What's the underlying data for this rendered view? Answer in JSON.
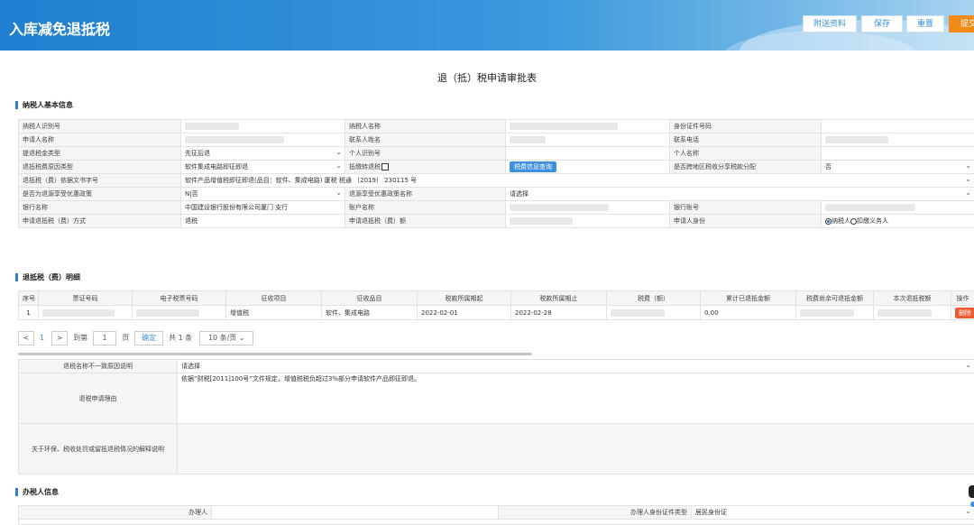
{
  "header": {
    "title": "入库减免退抵税",
    "attach_label": "附送资料",
    "save_label": "保存",
    "reset_label": "重置",
    "submit_label": "提交"
  },
  "page_title": "退（抵）税申请审批表",
  "sections": {
    "taxpayer": "纳税人基本信息",
    "detail": "退抵税（费）明细",
    "handler": "办税人信息"
  },
  "basic": {
    "taxpayer_id": "纳税人识别号",
    "taxpayer_name": "纳税人名称",
    "id_doc_no": "身份证件号码",
    "applicant_name": "申请人名称",
    "contact_name": "联系人姓名",
    "contact_phone": "联系电话",
    "refund_type": "提退税金类型",
    "refund_type_value": "先征后退",
    "personal_id": "个人识别号",
    "personal_name": "个人名称",
    "reason_type": "退抵税费原因类型",
    "reason_type_value": "软件集成电路即征即退",
    "convert_label": "抵缴转退税",
    "query_button": "税费信息查询",
    "cross_region": "是否跨地区税收分享税款分配",
    "cross_region_value": "否",
    "doc_no": "退抵税（费）依据文书字号",
    "doc_no_value": "软件产品增值税即征即退(品目：软件、集成电路) 厦税 税通 〔2019〕 230115 号",
    "is_pref": "是否为退源享受优惠政策",
    "is_pref_value": "N|否",
    "pref_name": "退源享受优惠政策名称",
    "pref_name_value": "请选择",
    "bank_name": "银行名称",
    "bank_name_value": "中国建设银行股份有限公司厦门      支行",
    "account_name": "账户名称",
    "bank_account": "银行账号",
    "method": "申请退抵税（费）方式",
    "method_value": "退税",
    "amount": "申请退抵税（费）额",
    "identity": "申请人身份",
    "identity_opt1": "纳税人",
    "identity_opt2": "扣缴义务人"
  },
  "detail_table": {
    "headers": [
      "序号",
      "票证号码",
      "电子税票号码",
      "征收项目",
      "征收品目",
      "税款所属期起",
      "税款所属期止",
      "税费（额）",
      "累计已退抵金额",
      "税费尚余可退抵金额",
      "本次退抵税额",
      "操作"
    ],
    "rows": [
      {
        "seq": "1",
        "ticket": "",
        "eticket": "",
        "item": "增值税",
        "subitem": "软件、集成电路",
        "start": "2022-02-01",
        "end": "2022-02-28",
        "amount": "",
        "refunded": "0.00",
        "remain": "",
        "current": "",
        "op": "删除"
      }
    ]
  },
  "pager": {
    "current": "1",
    "goto_label": "到第",
    "page_label": "页",
    "confirm": "确定",
    "total": "共 1 条",
    "per_page": "10 条/页"
  },
  "reason": {
    "mismatch_label": "退税名称不一致原因说明",
    "mismatch_value": "请选择",
    "apply_label": "退税申请理由",
    "apply_value": "依据“财税[2011]100号”文件规定，增值税税负超过3%部分申请软件产品即征即退。",
    "env_label": "关于环保、税收处罚或留抵退税情况的解释说明",
    "env_value": ""
  },
  "handler": {
    "name_label": "办理人",
    "id_type_label": "办理人身份证件类型",
    "id_type_value": "居民身份证"
  }
}
